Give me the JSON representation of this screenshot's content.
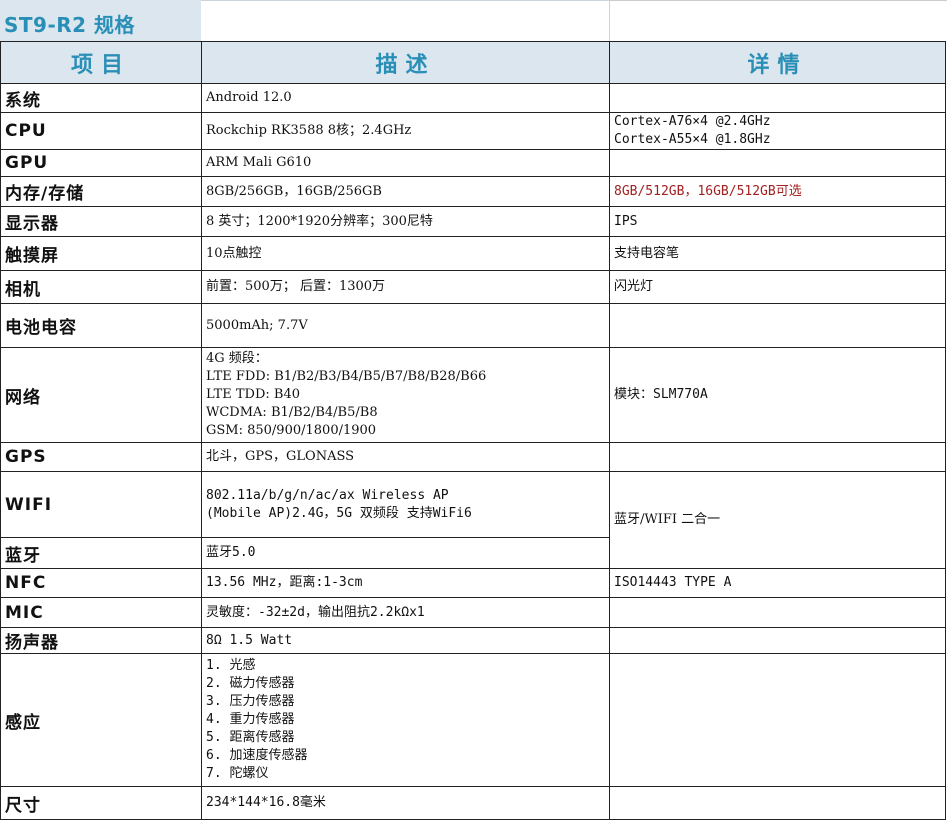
{
  "title": "ST9-R2 规格",
  "headers": {
    "item": "项目",
    "desc": "描述",
    "detail": "详情"
  },
  "rows": [
    {
      "item": "系统",
      "desc": [
        "Android 12.0"
      ],
      "detail": []
    },
    {
      "item": "CPU",
      "desc": [
        "Rockchip RK3588 8核；2.4GHz"
      ],
      "detail": [
        "Cortex-A76×4 @2.4GHz",
        "Cortex-A55×4 @1.8GHz"
      ]
    },
    {
      "item": "GPU",
      "desc": [
        "ARM Mali G610"
      ],
      "detail": []
    },
    {
      "item": "内存/存储",
      "desc": [
        "8GB/256GB，16GB/256GB"
      ],
      "detail": [
        "8GB/512GB，16GB/512GB可选"
      ],
      "detail_color": "#a32020"
    },
    {
      "item": "显示器",
      "desc": [
        "8 英寸；1200*1920分辨率；300尼特"
      ],
      "detail": [
        "IPS"
      ]
    },
    {
      "item": "触摸屏",
      "desc": [
        "10点触控"
      ],
      "detail": [
        "支持电容笔"
      ]
    },
    {
      "item": "相机",
      "desc": [
        "前置：500万；  后置：1300万"
      ],
      "detail": [
        "闪光灯"
      ]
    },
    {
      "item": "电池电容",
      "desc": [
        "5000mAh; 7.7V"
      ],
      "detail": []
    },
    {
      "item": "网络",
      "desc": [
        "4G 频段：",
        "LTE FDD: B1/B2/B3/B4/B5/B7/B8/B28/B66",
        "LTE TDD: B40",
        "WCDMA: B1/B2/B4/B5/B8",
        "GSM: 850/900/1800/1900"
      ],
      "detail": [
        "模块：SLM770A"
      ]
    },
    {
      "item": "GPS",
      "desc": [
        "北斗，GPS，GLONASS"
      ],
      "detail": []
    },
    {
      "item": "WIFI",
      "desc": [
        "802.11a/b/g/n/ac/ax Wireless AP",
        "(Mobile AP)2.4G，5G 双频段  支持WiFi6"
      ],
      "detail": [
        "蓝牙/WIFI 二合一"
      ]
    },
    {
      "item": "蓝牙",
      "desc": [
        "蓝牙5.0"
      ],
      "detail": []
    },
    {
      "item": "NFC",
      "desc": [
        "13.56 MHz，距离:1-3cm"
      ],
      "detail": [
        "ISO14443 TYPE A"
      ]
    },
    {
      "item": "MIC",
      "desc": [
        "灵敏度：-32±2d，输出阻抗2.2kΩx1"
      ],
      "detail": []
    },
    {
      "item": "扬声器",
      "desc": [
        "8Ω 1.5 Watt"
      ],
      "detail": []
    },
    {
      "item": "感应",
      "desc": [
        "1.  光感",
        "2.  磁力传感器",
        "3.  压力传感器",
        "4.  重力传感器",
        "5.  距离传感器",
        "6.  加速度传感器",
        "7.  陀螺仪"
      ],
      "detail": []
    },
    {
      "item": "尺寸",
      "desc": [
        "234*144*16.8毫米"
      ],
      "detail": []
    }
  ]
}
